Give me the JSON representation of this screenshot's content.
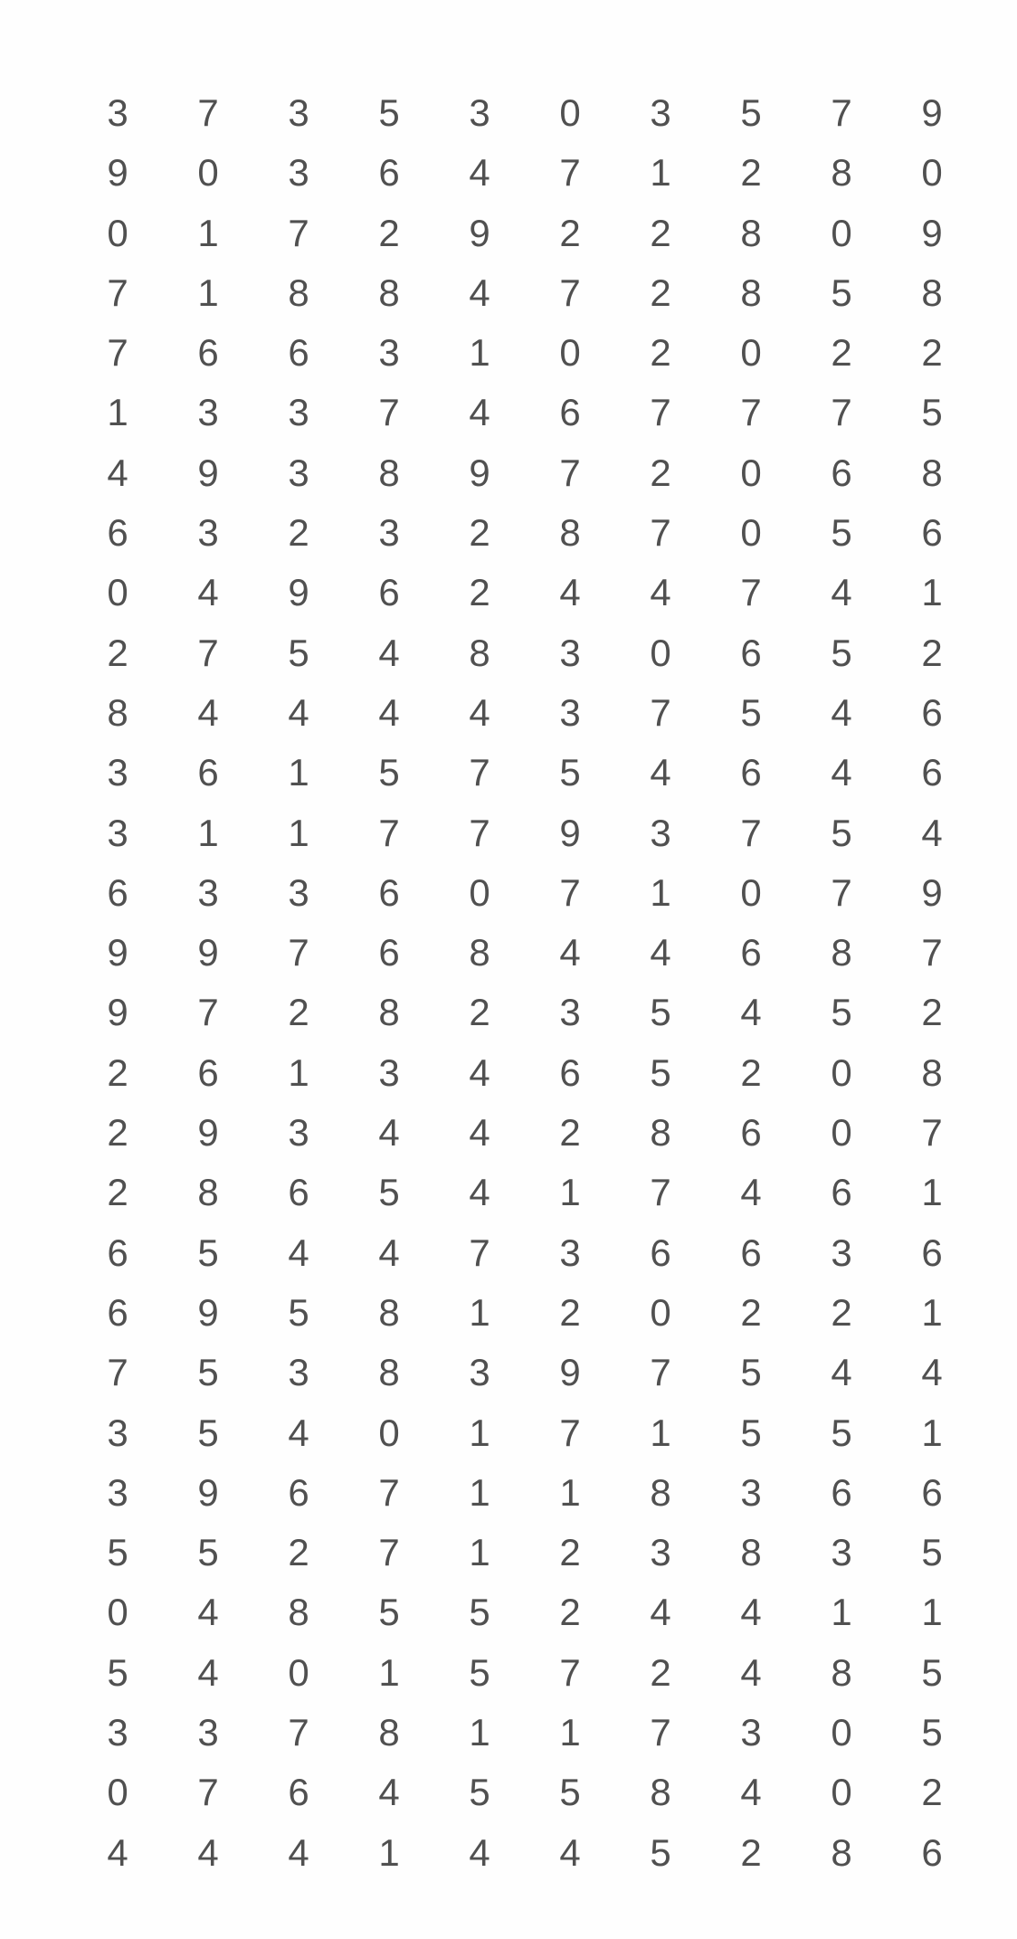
{
  "rows": [
    [
      "3",
      "7",
      "3",
      "5",
      "3",
      "0",
      "3",
      "5",
      "7",
      "9"
    ],
    [
      "9",
      "0",
      "3",
      "6",
      "4",
      "7",
      "1",
      "2",
      "8",
      "0"
    ],
    [
      "0",
      "1",
      "7",
      "2",
      "9",
      "2",
      "2",
      "8",
      "0",
      "9"
    ],
    [
      "7",
      "1",
      "8",
      "8",
      "4",
      "7",
      "2",
      "8",
      "5",
      "8"
    ],
    [
      "7",
      "6",
      "6",
      "3",
      "1",
      "0",
      "2",
      "0",
      "2",
      "2"
    ],
    [
      "1",
      "3",
      "3",
      "7",
      "4",
      "6",
      "7",
      "7",
      "7",
      "5"
    ],
    [
      "4",
      "9",
      "3",
      "8",
      "9",
      "7",
      "2",
      "0",
      "6",
      "8"
    ],
    [
      "6",
      "3",
      "2",
      "3",
      "2",
      "8",
      "7",
      "0",
      "5",
      "6"
    ],
    [
      "0",
      "4",
      "9",
      "6",
      "2",
      "4",
      "4",
      "7",
      "4",
      "1"
    ],
    [
      "2",
      "7",
      "5",
      "4",
      "8",
      "3",
      "0",
      "6",
      "5",
      "2"
    ],
    [
      "8",
      "4",
      "4",
      "4",
      "4",
      "3",
      "7",
      "5",
      "4",
      "6"
    ],
    [
      "3",
      "6",
      "1",
      "5",
      "7",
      "5",
      "4",
      "6",
      "4",
      "6"
    ],
    [
      "3",
      "1",
      "1",
      "7",
      "7",
      "9",
      "3",
      "7",
      "5",
      "4"
    ],
    [
      "6",
      "3",
      "3",
      "6",
      "0",
      "7",
      "1",
      "0",
      "7",
      "9"
    ],
    [
      "9",
      "9",
      "7",
      "6",
      "8",
      "4",
      "4",
      "6",
      "8",
      "7"
    ],
    [
      "9",
      "7",
      "2",
      "8",
      "2",
      "3",
      "5",
      "4",
      "5",
      "2"
    ],
    [
      "2",
      "6",
      "1",
      "3",
      "4",
      "6",
      "5",
      "2",
      "0",
      "8"
    ],
    [
      "2",
      "9",
      "3",
      "4",
      "4",
      "2",
      "8",
      "6",
      "0",
      "7"
    ],
    [
      "2",
      "8",
      "6",
      "5",
      "4",
      "1",
      "7",
      "4",
      "6",
      "1"
    ],
    [
      "6",
      "5",
      "4",
      "4",
      "7",
      "3",
      "6",
      "6",
      "3",
      "6"
    ],
    [
      "6",
      "9",
      "5",
      "8",
      "1",
      "2",
      "0",
      "2",
      "2",
      "1"
    ],
    [
      "7",
      "5",
      "3",
      "8",
      "3",
      "9",
      "7",
      "5",
      "4",
      "4"
    ],
    [
      "3",
      "5",
      "4",
      "0",
      "1",
      "7",
      "1",
      "5",
      "5",
      "1"
    ],
    [
      "3",
      "9",
      "6",
      "7",
      "1",
      "1",
      "8",
      "3",
      "6",
      "6"
    ],
    [
      "5",
      "5",
      "2",
      "7",
      "1",
      "2",
      "3",
      "8",
      "3",
      "5"
    ],
    [
      "0",
      "4",
      "8",
      "5",
      "5",
      "2",
      "4",
      "4",
      "1",
      "1"
    ],
    [
      "5",
      "4",
      "0",
      "1",
      "5",
      "7",
      "2",
      "4",
      "8",
      "5"
    ],
    [
      "3",
      "3",
      "7",
      "8",
      "1",
      "1",
      "7",
      "3",
      "0",
      "5"
    ],
    [
      "0",
      "7",
      "6",
      "4",
      "5",
      "5",
      "8",
      "4",
      "0",
      "2"
    ],
    [
      "4",
      "4",
      "4",
      "1",
      "4",
      "4",
      "5",
      "2",
      "8",
      "6"
    ]
  ]
}
